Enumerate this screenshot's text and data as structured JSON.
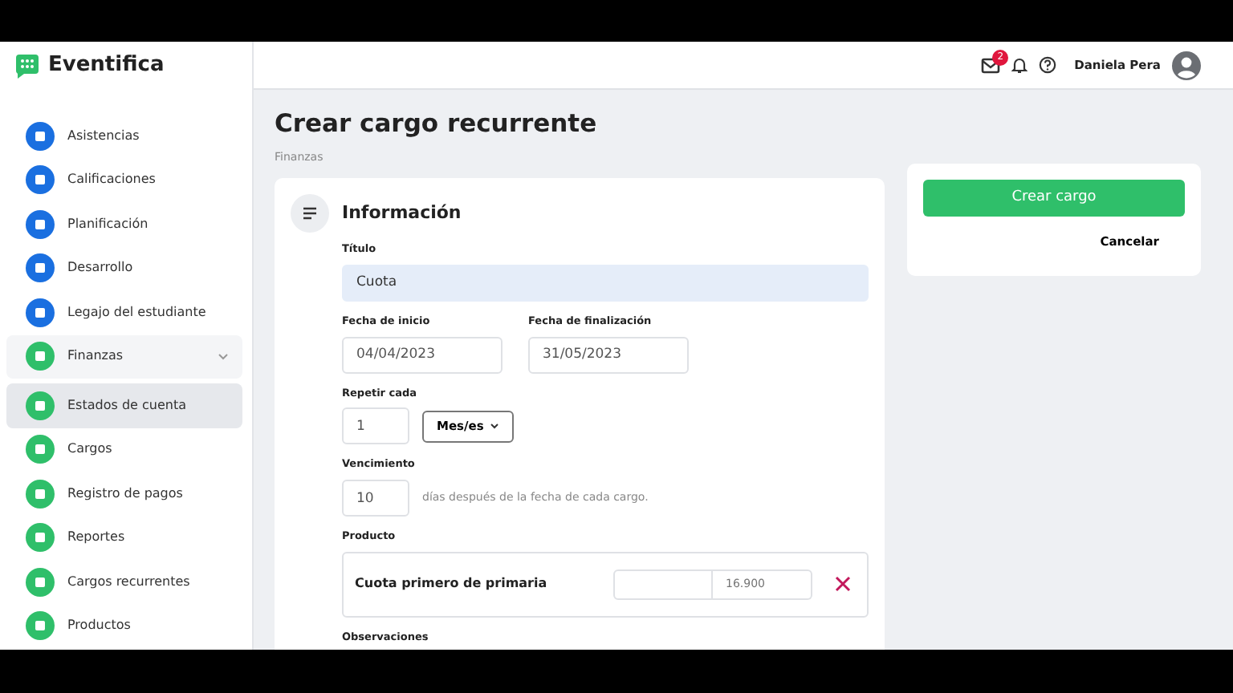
{
  "brand": "Eventifica",
  "sidebar": {
    "items": [
      {
        "label": "Asistencias",
        "color": "#1a6fe0",
        "selected": false
      },
      {
        "label": "Calificaciones",
        "color": "#1a6fe0",
        "selected": false
      },
      {
        "label": "Planificación",
        "color": "#1a6fe0",
        "selected": false
      },
      {
        "label": "Desarrollo",
        "color": "#1a6fe0",
        "selected": false
      },
      {
        "label": "Legajo del estudiante",
        "color": "#1a6fe0",
        "selected": false
      },
      {
        "label": "Finanzas",
        "color": "#2fbf6a",
        "selected": false,
        "expanded": true,
        "children": [
          {
            "label": "Estados de cuenta",
            "color": "#2fbf6a",
            "selected": true
          },
          {
            "label": "Cargos",
            "color": "#2fbf6a",
            "selected": false
          },
          {
            "label": "Registro de pagos",
            "color": "#2fbf6a",
            "selected": false
          },
          {
            "label": "Reportes",
            "color": "#2fbf6a",
            "selected": false
          },
          {
            "label": "Cargos recurrentes",
            "color": "#2fbf6a",
            "selected": false
          },
          {
            "label": "Productos",
            "color": "#2fbf6a",
            "selected": false
          }
        ]
      }
    ]
  },
  "header": {
    "mail_badge": "2",
    "user": "Daniela Pera"
  },
  "page": {
    "title": "Crear cargo recurrente",
    "breadcrumb": "Finanzas"
  },
  "form": {
    "section": "Información",
    "titulo": {
      "label": "Título",
      "value": "Cuota"
    },
    "fecha_inicio": {
      "label": "Fecha de inicio",
      "value": "04/04/2023"
    },
    "fecha_fin": {
      "label": "Fecha de finalización",
      "value": "31/05/2023"
    },
    "repetir": {
      "label": "Repetir cada",
      "value": "1",
      "unit": "Mes/es"
    },
    "vencimiento": {
      "label": "Vencimiento",
      "value": "10",
      "hint": "días después de la fecha de cada cargo."
    },
    "producto": {
      "label": "Producto",
      "name": "Cuota primero de primaria",
      "price_placeholder": "16.900"
    },
    "observaciones": {
      "label": "Observaciones"
    }
  },
  "actions": {
    "primary": "Crear cargo",
    "secondary": "Cancelar"
  }
}
